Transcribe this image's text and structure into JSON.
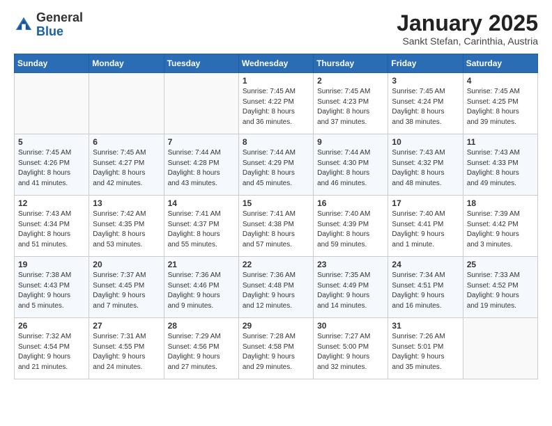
{
  "header": {
    "logo_general": "General",
    "logo_blue": "Blue",
    "month_title": "January 2025",
    "location": "Sankt Stefan, Carinthia, Austria"
  },
  "days_of_week": [
    "Sunday",
    "Monday",
    "Tuesday",
    "Wednesday",
    "Thursday",
    "Friday",
    "Saturday"
  ],
  "weeks": [
    [
      {
        "day": "",
        "info": ""
      },
      {
        "day": "",
        "info": ""
      },
      {
        "day": "",
        "info": ""
      },
      {
        "day": "1",
        "info": "Sunrise: 7:45 AM\nSunset: 4:22 PM\nDaylight: 8 hours\nand 36 minutes."
      },
      {
        "day": "2",
        "info": "Sunrise: 7:45 AM\nSunset: 4:23 PM\nDaylight: 8 hours\nand 37 minutes."
      },
      {
        "day": "3",
        "info": "Sunrise: 7:45 AM\nSunset: 4:24 PM\nDaylight: 8 hours\nand 38 minutes."
      },
      {
        "day": "4",
        "info": "Sunrise: 7:45 AM\nSunset: 4:25 PM\nDaylight: 8 hours\nand 39 minutes."
      }
    ],
    [
      {
        "day": "5",
        "info": "Sunrise: 7:45 AM\nSunset: 4:26 PM\nDaylight: 8 hours\nand 41 minutes."
      },
      {
        "day": "6",
        "info": "Sunrise: 7:45 AM\nSunset: 4:27 PM\nDaylight: 8 hours\nand 42 minutes."
      },
      {
        "day": "7",
        "info": "Sunrise: 7:44 AM\nSunset: 4:28 PM\nDaylight: 8 hours\nand 43 minutes."
      },
      {
        "day": "8",
        "info": "Sunrise: 7:44 AM\nSunset: 4:29 PM\nDaylight: 8 hours\nand 45 minutes."
      },
      {
        "day": "9",
        "info": "Sunrise: 7:44 AM\nSunset: 4:30 PM\nDaylight: 8 hours\nand 46 minutes."
      },
      {
        "day": "10",
        "info": "Sunrise: 7:43 AM\nSunset: 4:32 PM\nDaylight: 8 hours\nand 48 minutes."
      },
      {
        "day": "11",
        "info": "Sunrise: 7:43 AM\nSunset: 4:33 PM\nDaylight: 8 hours\nand 49 minutes."
      }
    ],
    [
      {
        "day": "12",
        "info": "Sunrise: 7:43 AM\nSunset: 4:34 PM\nDaylight: 8 hours\nand 51 minutes."
      },
      {
        "day": "13",
        "info": "Sunrise: 7:42 AM\nSunset: 4:35 PM\nDaylight: 8 hours\nand 53 minutes."
      },
      {
        "day": "14",
        "info": "Sunrise: 7:41 AM\nSunset: 4:37 PM\nDaylight: 8 hours\nand 55 minutes."
      },
      {
        "day": "15",
        "info": "Sunrise: 7:41 AM\nSunset: 4:38 PM\nDaylight: 8 hours\nand 57 minutes."
      },
      {
        "day": "16",
        "info": "Sunrise: 7:40 AM\nSunset: 4:39 PM\nDaylight: 8 hours\nand 59 minutes."
      },
      {
        "day": "17",
        "info": "Sunrise: 7:40 AM\nSunset: 4:41 PM\nDaylight: 9 hours\nand 1 minute."
      },
      {
        "day": "18",
        "info": "Sunrise: 7:39 AM\nSunset: 4:42 PM\nDaylight: 9 hours\nand 3 minutes."
      }
    ],
    [
      {
        "day": "19",
        "info": "Sunrise: 7:38 AM\nSunset: 4:43 PM\nDaylight: 9 hours\nand 5 minutes."
      },
      {
        "day": "20",
        "info": "Sunrise: 7:37 AM\nSunset: 4:45 PM\nDaylight: 9 hours\nand 7 minutes."
      },
      {
        "day": "21",
        "info": "Sunrise: 7:36 AM\nSunset: 4:46 PM\nDaylight: 9 hours\nand 9 minutes."
      },
      {
        "day": "22",
        "info": "Sunrise: 7:36 AM\nSunset: 4:48 PM\nDaylight: 9 hours\nand 12 minutes."
      },
      {
        "day": "23",
        "info": "Sunrise: 7:35 AM\nSunset: 4:49 PM\nDaylight: 9 hours\nand 14 minutes."
      },
      {
        "day": "24",
        "info": "Sunrise: 7:34 AM\nSunset: 4:51 PM\nDaylight: 9 hours\nand 16 minutes."
      },
      {
        "day": "25",
        "info": "Sunrise: 7:33 AM\nSunset: 4:52 PM\nDaylight: 9 hours\nand 19 minutes."
      }
    ],
    [
      {
        "day": "26",
        "info": "Sunrise: 7:32 AM\nSunset: 4:54 PM\nDaylight: 9 hours\nand 21 minutes."
      },
      {
        "day": "27",
        "info": "Sunrise: 7:31 AM\nSunset: 4:55 PM\nDaylight: 9 hours\nand 24 minutes."
      },
      {
        "day": "28",
        "info": "Sunrise: 7:29 AM\nSunset: 4:56 PM\nDaylight: 9 hours\nand 27 minutes."
      },
      {
        "day": "29",
        "info": "Sunrise: 7:28 AM\nSunset: 4:58 PM\nDaylight: 9 hours\nand 29 minutes."
      },
      {
        "day": "30",
        "info": "Sunrise: 7:27 AM\nSunset: 5:00 PM\nDaylight: 9 hours\nand 32 minutes."
      },
      {
        "day": "31",
        "info": "Sunrise: 7:26 AM\nSunset: 5:01 PM\nDaylight: 9 hours\nand 35 minutes."
      },
      {
        "day": "",
        "info": ""
      }
    ]
  ]
}
